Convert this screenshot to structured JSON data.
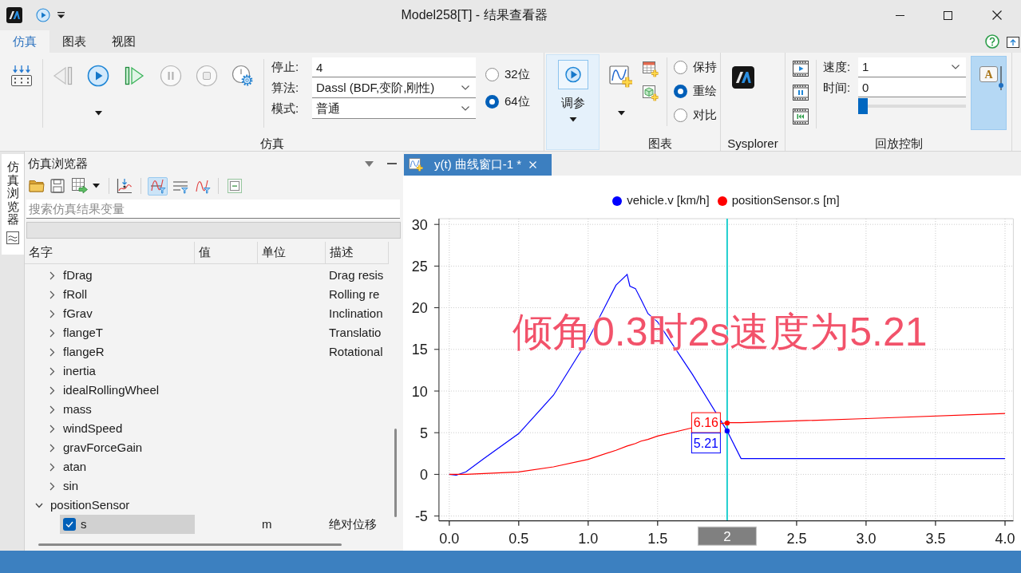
{
  "title_bar": {
    "title": "Model258[T] - 结果查看器"
  },
  "ribbon_tabs": [
    {
      "label": "仿真",
      "selected": true
    },
    {
      "label": "图表",
      "selected": false
    },
    {
      "label": "视图",
      "selected": false
    }
  ],
  "ribbon": {
    "simulation": {
      "label": "仿真",
      "controls": [
        {
          "kind": "step-back",
          "disabled": true
        },
        {
          "kind": "run",
          "disabled": false
        },
        {
          "kind": "step-forward",
          "disabled": false
        },
        {
          "kind": "pause",
          "disabled": true
        },
        {
          "kind": "stop",
          "disabled": true
        },
        {
          "kind": "settings",
          "disabled": false
        }
      ],
      "fields": [
        {
          "label": "停止:",
          "kind": "input",
          "value": "4"
        },
        {
          "label": "算法:",
          "kind": "dropdown",
          "value": "Dassl (BDF,变阶,刚性)"
        },
        {
          "label": "模式:",
          "kind": "dropdown",
          "value": "普通"
        }
      ],
      "precision": [
        {
          "label": "32位",
          "selected": false
        },
        {
          "label": "64位",
          "selected": true
        }
      ]
    },
    "tune_button": {
      "label": "调参",
      "pressed": true
    },
    "chart": {
      "label": "图表",
      "modes": [
        {
          "label": "保持",
          "selected": false
        },
        {
          "label": "重绘",
          "selected": true
        },
        {
          "label": "对比",
          "selected": false
        }
      ]
    },
    "sysplorer": {
      "label": "Sysplorer"
    },
    "playback": {
      "label": "回放控制",
      "fields": [
        {
          "label": "速度:",
          "kind": "dropdown",
          "value": "1"
        },
        {
          "label": "时间:",
          "kind": "input",
          "value": "0"
        }
      ],
      "position": {
        "level": 0
      },
      "annotation_toggle": {
        "glyph": "A",
        "on": true
      }
    }
  },
  "side_tabs": [
    {
      "label": "仿真浏览器",
      "selected": true
    }
  ],
  "browser_panel": {
    "title": "仿真浏览器",
    "view_toggles": [
      {
        "selected": true
      },
      {
        "selected": false
      },
      {
        "selected": false
      }
    ],
    "search": {
      "placeholder": "搜索仿真结果变量"
    },
    "columns": [
      "名字",
      "值",
      "单位",
      "描述"
    ],
    "tree": [
      {
        "children": [
          {
            "name": "fDrag",
            "kind": "group",
            "expanded": false,
            "selected": false,
            "description": "Drag resis"
          },
          {
            "name": "fRoll",
            "kind": "group",
            "expanded": false,
            "selected": false,
            "description": "Rolling re"
          },
          {
            "name": "fGrav",
            "kind": "group",
            "expanded": false,
            "selected": false,
            "description": "Inclination"
          },
          {
            "name": "flangeT",
            "kind": "group",
            "expanded": false,
            "selected": false,
            "description": "Translatio"
          },
          {
            "name": "flangeR",
            "kind": "group",
            "expanded": false,
            "selected": false,
            "description": "Rotational"
          },
          {
            "name": "inertia",
            "kind": "group",
            "expanded": false,
            "selected": false
          },
          {
            "name": "idealRollingWheel",
            "kind": "group",
            "expanded": false,
            "selected": false
          },
          {
            "name": "mass",
            "kind": "group",
            "expanded": false,
            "selected": false
          },
          {
            "name": "windSpeed",
            "kind": "group",
            "expanded": false,
            "selected": false
          },
          {
            "name": "gravForceGain",
            "kind": "group",
            "expanded": false,
            "selected": false
          },
          {
            "name": "atan",
            "kind": "group",
            "expanded": false,
            "selected": false
          },
          {
            "name": "sin",
            "kind": "group",
            "expanded": false,
            "selected": false
          }
        ]
      },
      {
        "name": "positionSensor",
        "kind": "group",
        "expanded": true,
        "selected": false,
        "children": [
          {
            "name": "s",
            "kind": "variable",
            "checked": true,
            "selected": true,
            "unit": "m",
            "description": "绝对位移"
          }
        ]
      }
    ]
  },
  "chart_tabs": [
    {
      "title": "y(t) 曲线窗口-1 *",
      "selected": true
    }
  ],
  "chart": {
    "chart_data": {
      "type": "line",
      "x": [
        0,
        0.05,
        0.12,
        0.25,
        0.5,
        0.75,
        1.0,
        1.2,
        1.28,
        1.3,
        1.34,
        1.38,
        1.43,
        1.5,
        1.75,
        2.0,
        2.1,
        3.0,
        4.0
      ],
      "series": [
        {
          "name": "vehicle.v [km/h]",
          "color": "#0000ff",
          "values": [
            0,
            -0.1,
            0.3,
            1.9,
            4.9,
            9.5,
            16.2,
            22.7,
            24.0,
            22.6,
            22.3,
            21.0,
            19.3,
            18.3,
            12.0,
            5.2,
            1.9,
            1.9,
            1.9
          ]
        },
        {
          "name": "positionSensor.s [m]",
          "color": "#ff0000",
          "values": [
            0,
            0,
            0,
            0.1,
            0.3,
            0.9,
            1.8,
            2.9,
            3.4,
            3.5,
            3.7,
            4.0,
            4.2,
            4.6,
            5.6,
            6.2,
            6.2,
            6.7,
            7.3
          ]
        }
      ],
      "xlim": [
        -0.074,
        4.06
      ],
      "ylim": [
        -5.58,
        30.69
      ],
      "xticks": [
        {
          "value": 0,
          "label": "0.0"
        },
        {
          "value": 0.5,
          "label": "0.5"
        },
        {
          "value": 1,
          "label": "1.0"
        },
        {
          "value": 1.5,
          "label": "1.5"
        },
        {
          "value": 2.5,
          "label": "2.5"
        },
        {
          "value": 3,
          "label": "3.0"
        },
        {
          "value": 3.5,
          "label": "3.5"
        },
        {
          "value": 4,
          "label": "4.0"
        }
      ],
      "yticks": [
        {
          "value": -5,
          "label": "-5"
        },
        {
          "value": 0,
          "label": "0"
        },
        {
          "value": 5,
          "label": "5"
        },
        {
          "value": 10,
          "label": "10"
        },
        {
          "value": 15,
          "label": "15"
        },
        {
          "value": 20,
          "label": "20"
        },
        {
          "value": 25,
          "label": "25"
        },
        {
          "value": 30,
          "label": "30"
        }
      ],
      "grid": true,
      "legend": "top",
      "ref_lines": [
        {
          "axis": "x",
          "value": 2,
          "label": "2"
        }
      ],
      "annotations": [
        {
          "text": "6.16",
          "x": 2,
          "y": 6.16
        },
        {
          "text": "5.21",
          "x": 2,
          "y": 5.21
        }
      ]
    },
    "note": "倾角0.3时2s速度为5.21"
  }
}
